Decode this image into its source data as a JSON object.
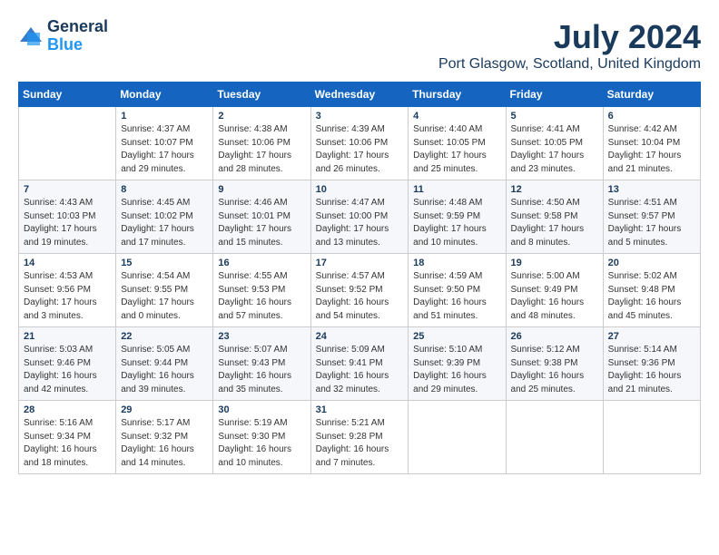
{
  "header": {
    "logo_line1": "General",
    "logo_line2": "Blue",
    "month": "July 2024",
    "location": "Port Glasgow, Scotland, United Kingdom"
  },
  "weekdays": [
    "Sunday",
    "Monday",
    "Tuesday",
    "Wednesday",
    "Thursday",
    "Friday",
    "Saturday"
  ],
  "weeks": [
    [
      {
        "day": "",
        "info": ""
      },
      {
        "day": "1",
        "info": "Sunrise: 4:37 AM\nSunset: 10:07 PM\nDaylight: 17 hours\nand 29 minutes."
      },
      {
        "day": "2",
        "info": "Sunrise: 4:38 AM\nSunset: 10:06 PM\nDaylight: 17 hours\nand 28 minutes."
      },
      {
        "day": "3",
        "info": "Sunrise: 4:39 AM\nSunset: 10:06 PM\nDaylight: 17 hours\nand 26 minutes."
      },
      {
        "day": "4",
        "info": "Sunrise: 4:40 AM\nSunset: 10:05 PM\nDaylight: 17 hours\nand 25 minutes."
      },
      {
        "day": "5",
        "info": "Sunrise: 4:41 AM\nSunset: 10:05 PM\nDaylight: 17 hours\nand 23 minutes."
      },
      {
        "day": "6",
        "info": "Sunrise: 4:42 AM\nSunset: 10:04 PM\nDaylight: 17 hours\nand 21 minutes."
      }
    ],
    [
      {
        "day": "7",
        "info": "Sunrise: 4:43 AM\nSunset: 10:03 PM\nDaylight: 17 hours\nand 19 minutes."
      },
      {
        "day": "8",
        "info": "Sunrise: 4:45 AM\nSunset: 10:02 PM\nDaylight: 17 hours\nand 17 minutes."
      },
      {
        "day": "9",
        "info": "Sunrise: 4:46 AM\nSunset: 10:01 PM\nDaylight: 17 hours\nand 15 minutes."
      },
      {
        "day": "10",
        "info": "Sunrise: 4:47 AM\nSunset: 10:00 PM\nDaylight: 17 hours\nand 13 minutes."
      },
      {
        "day": "11",
        "info": "Sunrise: 4:48 AM\nSunset: 9:59 PM\nDaylight: 17 hours\nand 10 minutes."
      },
      {
        "day": "12",
        "info": "Sunrise: 4:50 AM\nSunset: 9:58 PM\nDaylight: 17 hours\nand 8 minutes."
      },
      {
        "day": "13",
        "info": "Sunrise: 4:51 AM\nSunset: 9:57 PM\nDaylight: 17 hours\nand 5 minutes."
      }
    ],
    [
      {
        "day": "14",
        "info": "Sunrise: 4:53 AM\nSunset: 9:56 PM\nDaylight: 17 hours\nand 3 minutes."
      },
      {
        "day": "15",
        "info": "Sunrise: 4:54 AM\nSunset: 9:55 PM\nDaylight: 17 hours\nand 0 minutes."
      },
      {
        "day": "16",
        "info": "Sunrise: 4:55 AM\nSunset: 9:53 PM\nDaylight: 16 hours\nand 57 minutes."
      },
      {
        "day": "17",
        "info": "Sunrise: 4:57 AM\nSunset: 9:52 PM\nDaylight: 16 hours\nand 54 minutes."
      },
      {
        "day": "18",
        "info": "Sunrise: 4:59 AM\nSunset: 9:50 PM\nDaylight: 16 hours\nand 51 minutes."
      },
      {
        "day": "19",
        "info": "Sunrise: 5:00 AM\nSunset: 9:49 PM\nDaylight: 16 hours\nand 48 minutes."
      },
      {
        "day": "20",
        "info": "Sunrise: 5:02 AM\nSunset: 9:48 PM\nDaylight: 16 hours\nand 45 minutes."
      }
    ],
    [
      {
        "day": "21",
        "info": "Sunrise: 5:03 AM\nSunset: 9:46 PM\nDaylight: 16 hours\nand 42 minutes."
      },
      {
        "day": "22",
        "info": "Sunrise: 5:05 AM\nSunset: 9:44 PM\nDaylight: 16 hours\nand 39 minutes."
      },
      {
        "day": "23",
        "info": "Sunrise: 5:07 AM\nSunset: 9:43 PM\nDaylight: 16 hours\nand 35 minutes."
      },
      {
        "day": "24",
        "info": "Sunrise: 5:09 AM\nSunset: 9:41 PM\nDaylight: 16 hours\nand 32 minutes."
      },
      {
        "day": "25",
        "info": "Sunrise: 5:10 AM\nSunset: 9:39 PM\nDaylight: 16 hours\nand 29 minutes."
      },
      {
        "day": "26",
        "info": "Sunrise: 5:12 AM\nSunset: 9:38 PM\nDaylight: 16 hours\nand 25 minutes."
      },
      {
        "day": "27",
        "info": "Sunrise: 5:14 AM\nSunset: 9:36 PM\nDaylight: 16 hours\nand 21 minutes."
      }
    ],
    [
      {
        "day": "28",
        "info": "Sunrise: 5:16 AM\nSunset: 9:34 PM\nDaylight: 16 hours\nand 18 minutes."
      },
      {
        "day": "29",
        "info": "Sunrise: 5:17 AM\nSunset: 9:32 PM\nDaylight: 16 hours\nand 14 minutes."
      },
      {
        "day": "30",
        "info": "Sunrise: 5:19 AM\nSunset: 9:30 PM\nDaylight: 16 hours\nand 10 minutes."
      },
      {
        "day": "31",
        "info": "Sunrise: 5:21 AM\nSunset: 9:28 PM\nDaylight: 16 hours\nand 7 minutes."
      },
      {
        "day": "",
        "info": ""
      },
      {
        "day": "",
        "info": ""
      },
      {
        "day": "",
        "info": ""
      }
    ]
  ]
}
